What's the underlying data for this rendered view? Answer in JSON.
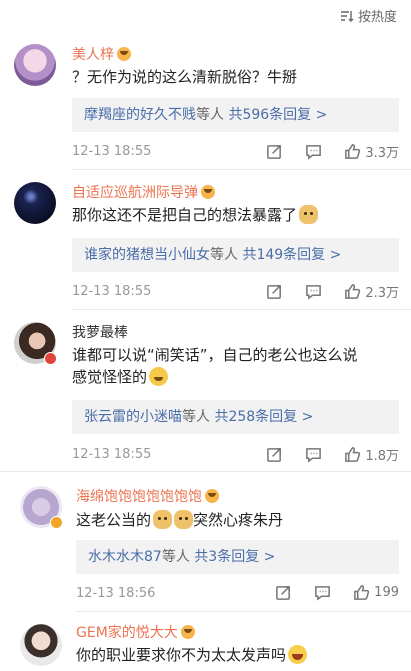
{
  "sort": {
    "label": "按热度",
    "icon": "sort-icon"
  },
  "comments": [
    {
      "name": "美人梓",
      "text": "？无作为说的这么清新脱俗？牛掰",
      "reply_users": "摩羯座的好久不贱",
      "reply_mid": "等人",
      "reply_count": "共596条回复 >",
      "time": "12-13 18:55",
      "likes": "3.3万"
    },
    {
      "name": "自适应巡航洲际导弹",
      "text": "那你这还不是把自己的想法暴露了",
      "reply_users": "谁家的猪想当小仙女",
      "reply_mid": "等人",
      "reply_count": "共149条回复 >",
      "time": "12-13 18:55",
      "likes": "2.3万"
    },
    {
      "name": "我萝最棒",
      "text_line1": "谁都可以说“闹笑话”，自己的老公也这么说",
      "text_line2": "感觉怪怪的",
      "reply_users": "张云雷的小迷喵",
      "reply_mid": "等人",
      "reply_count": "共258条回复 >",
      "time": "12-13 18:55",
      "likes": "1.8万"
    },
    {
      "name": "海绵饱饱饱饱饱饱饱",
      "text_a": "这老公当的",
      "text_b": "突然心疼朱丹",
      "reply_users": "水木水木87",
      "reply_mid": "等人",
      "reply_count": "共3条回复 >",
      "time": "12-13 18:56",
      "likes": "199"
    },
    {
      "name": "GEM家的悦大大",
      "text": "你的职业要求你不为太太发声吗"
    }
  ],
  "colors": {
    "orange_name": "#eb7350",
    "link": "#4a6ea9",
    "reply_bg": "#f2f2f2"
  }
}
